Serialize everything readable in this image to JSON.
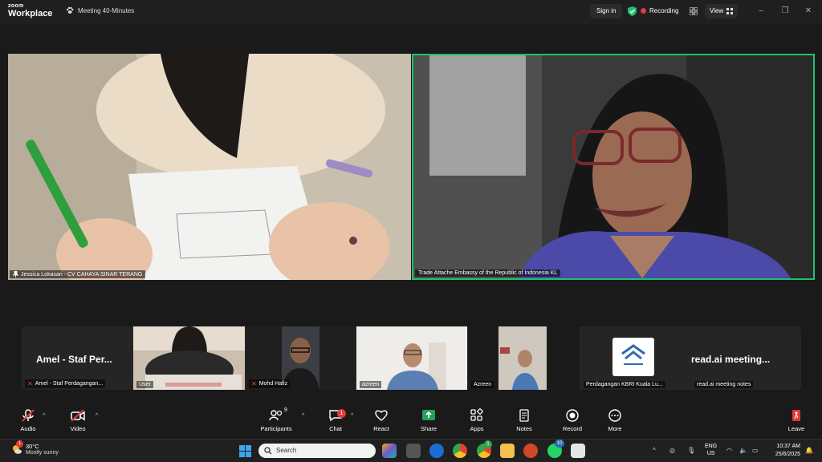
{
  "app": {
    "logo_line1": "zoom",
    "logo_line2": "Workplace",
    "meeting_title": "Meeting 40-Minutes",
    "sign_in": "Sign in",
    "recording": "Recording",
    "view": "View"
  },
  "videos": {
    "left_name": "Jessica Lokasari - CV CAHAYA SINAR TERANG",
    "right_name": "Trade Attache Embassy of the Republic of Indonesia KL"
  },
  "strip": {
    "tiles": [
      {
        "bigname": "Amel - Staf Per...",
        "name": "Amel - Staf Perdagangan..."
      },
      {
        "name": "User"
      },
      {
        "name": "Mohd Hafiz"
      },
      {
        "name": "azreen"
      },
      {
        "name": "Azreen"
      },
      {
        "name": "Perdagangan KBRI Kuala Lu..."
      },
      {
        "bigname": "read.ai  meeting...",
        "name": "read.ai meeting notes"
      }
    ]
  },
  "controls": {
    "audio": "Audio",
    "video": "Video",
    "participants": "Participants",
    "participants_count": "9",
    "chat": "Chat",
    "chat_badge": "1",
    "react": "React",
    "share": "Share",
    "apps": "Apps",
    "notes": "Notes",
    "record": "Record",
    "more": "More",
    "leave": "Leave"
  },
  "taskbar": {
    "weather_badge": "1",
    "temp": "30°C",
    "condition": "Mostly sunny",
    "search_placeholder": "Search",
    "chrome_badge": "1",
    "whatsapp_badge": "10",
    "lang1": "ENG",
    "lang2": "US",
    "time": "10:37 AM",
    "date": "25/6/2025"
  },
  "colors": {
    "active_speaker": "#1ec070",
    "share_green": "#23a35a",
    "leave_red": "#e03a3a",
    "recording_red": "#e03a3a"
  }
}
